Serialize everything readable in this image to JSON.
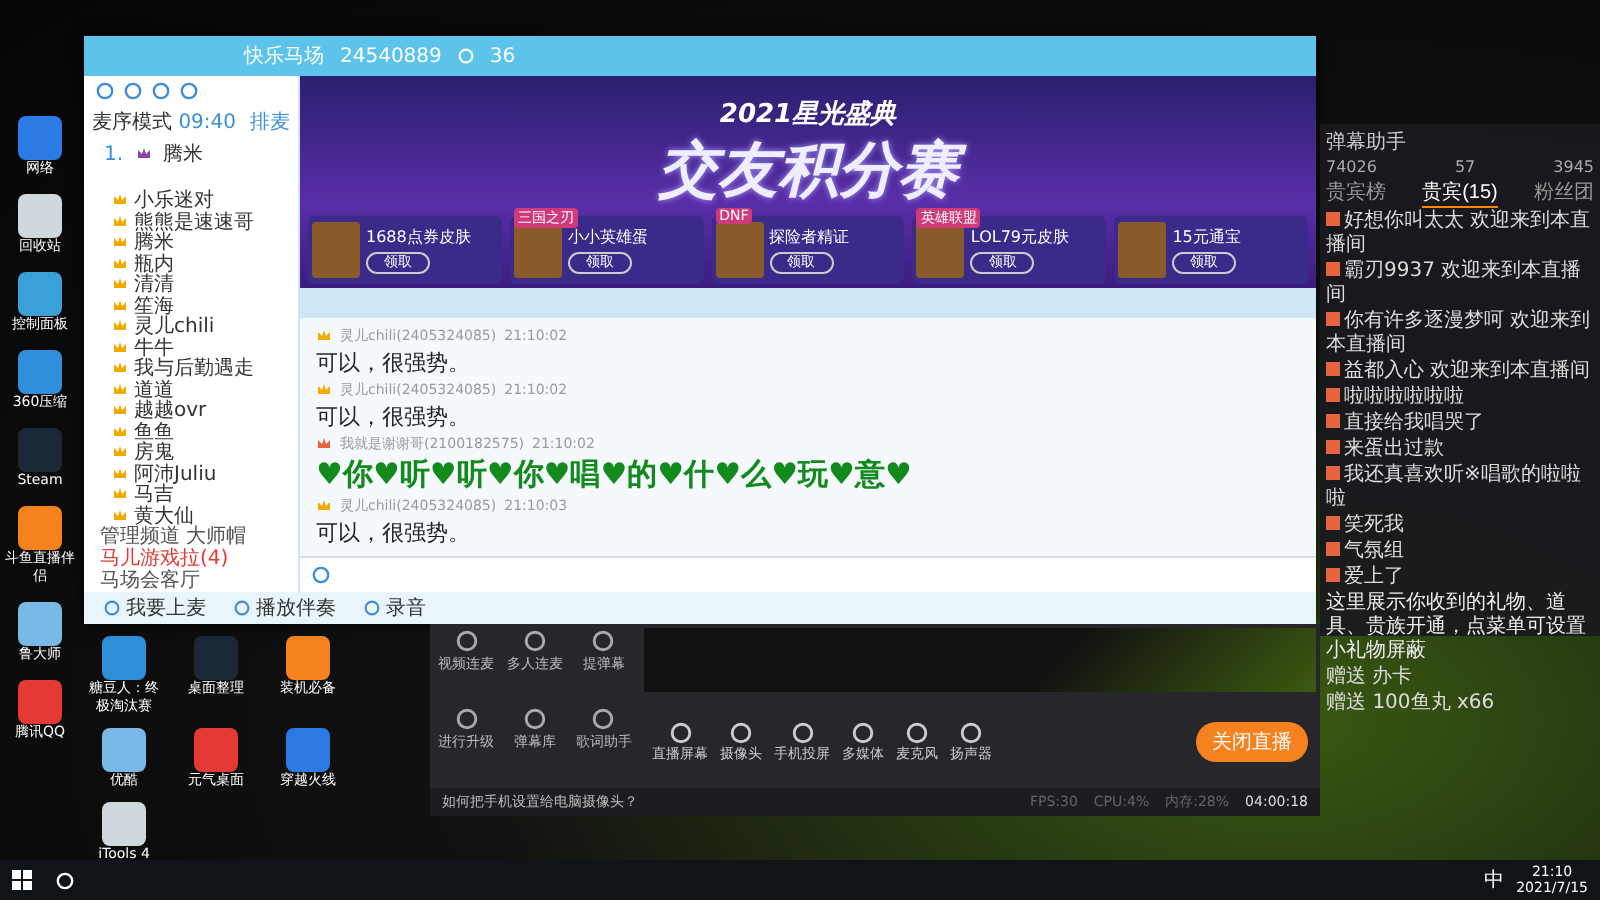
{
  "desktop_icons": [
    {
      "label": "网络"
    },
    {
      "label": "回收站"
    },
    {
      "label": "控制面板"
    },
    {
      "label": "360压缩"
    },
    {
      "label": "Steam"
    },
    {
      "label": "斗鱼直播伴侣"
    },
    {
      "label": "鲁大师"
    },
    {
      "label": "腾讯QQ"
    }
  ],
  "desktop_icons_bottom": [
    {
      "label": "糖豆人：终极淘汰赛"
    },
    {
      "label": "桌面整理"
    },
    {
      "label": "装机必备"
    },
    {
      "label": "优酷"
    },
    {
      "label": "元气桌面"
    },
    {
      "label": "穿越火线"
    },
    {
      "label": "iTools 4"
    }
  ],
  "group_window": {
    "title": "快乐马场",
    "room_id": "24540889",
    "online": "36",
    "mode": "麦序模式",
    "mode_time": "09:40",
    "queue_button": "排麦",
    "queue": [
      {
        "index": "1.",
        "name": "腾米"
      }
    ],
    "members": [
      {
        "name": "小乐迷对"
      },
      {
        "name": "熊熊是速速哥"
      },
      {
        "name": "腾米"
      },
      {
        "name": "瓶内"
      },
      {
        "name": "清清"
      },
      {
        "name": "笙海"
      },
      {
        "name": "灵儿chili"
      },
      {
        "name": "牛牛"
      },
      {
        "name": "我与后勤遇走"
      },
      {
        "name": "道道"
      },
      {
        "name": "越越ovr"
      },
      {
        "name": "鱼鱼"
      },
      {
        "name": "房鬼"
      },
      {
        "name": "阿沛Juliu"
      },
      {
        "name": "马吉"
      },
      {
        "name": "黄大仙"
      }
    ],
    "channels": [
      {
        "label": "管理频道 大师帽",
        "color": "#555555"
      },
      {
        "label": "马儿游戏拉(4)",
        "color": "#e53935"
      },
      {
        "label": "马场会客厅",
        "color": "#555555"
      }
    ],
    "toolbar": [
      {
        "label": "我要上麦"
      },
      {
        "label": "播放伴奏"
      },
      {
        "label": "录音"
      }
    ]
  },
  "banner": {
    "subtitle": "2021星光盛典",
    "title": "交友积分赛",
    "cards": [
      {
        "name": "1688点券皮肤",
        "button": "领取"
      },
      {
        "tag": "三国之刃",
        "name": "小小英雄蛋",
        "button": "领取"
      },
      {
        "tag": "DNF",
        "name": "探险者精证",
        "button": "领取"
      },
      {
        "tag": "英雄联盟",
        "name": "LOL79元皮肤",
        "button": "领取"
      },
      {
        "name": "15元通宝",
        "button": "领取"
      }
    ]
  },
  "messages": [
    {
      "kind": "plain",
      "sender": "灵儿chili(2405324085)",
      "time": "21:10:02",
      "text": "可以，很强势。"
    },
    {
      "kind": "plain",
      "sender": "灵儿chili(2405324085)",
      "time": "21:10:02",
      "text": "可以，很强势。"
    },
    {
      "kind": "big",
      "sender": "我就是谢谢哥(2100182575)",
      "time": "21:10:02",
      "text": "♥你♥听♥听♥你♥唱♥的♥什♥么♥玩♥意♥"
    },
    {
      "kind": "plain",
      "sender": "灵儿chili(2405324085)",
      "time": "21:10:03",
      "text": "可以，很强势。"
    }
  ],
  "right_panel": {
    "title": "弹幕助手",
    "stats": [
      {
        "value": "74026"
      },
      {
        "value": "57"
      },
      {
        "value": "3945"
      }
    ],
    "tabs": [
      {
        "label": "贵宾榜",
        "selected": false
      },
      {
        "label": "贵宾(15)",
        "selected": true
      },
      {
        "label": "粉丝团",
        "selected": false
      }
    ],
    "welcomes": [
      {
        "name": "好想你叫太太",
        "text": "欢迎来到本直播间"
      },
      {
        "name": "霸刃9937",
        "text": "欢迎来到本直播间"
      },
      {
        "name": "你有许多逐漫梦呵",
        "text": "欢迎来到本直播间"
      },
      {
        "name": "益都入心",
        "text": "欢迎来到本直播间"
      }
    ],
    "chat": [
      {
        "text": "啦啦啦啦啦啦"
      },
      {
        "text": "直接给我唱哭了"
      },
      {
        "text": "来蛋出过款"
      },
      {
        "text": "我还真喜欢听※唱歌的啦啦啦"
      },
      {
        "text": "笑死我"
      },
      {
        "text": "气氛组"
      },
      {
        "text": "爱上了"
      }
    ],
    "notice": "这里展示你收到的礼物、道具、贵族开通，点菜单可设置小礼物屏蔽",
    "gifts": [
      {
        "verb": "赠送",
        "item": "办卡"
      },
      {
        "verb": "赠送",
        "item": "100鱼丸",
        "count": "x66"
      }
    ]
  },
  "stream_app": {
    "tools": [
      {
        "label": "视频连麦"
      },
      {
        "label": "多人连麦"
      },
      {
        "label": "提弹幕"
      },
      {
        "label": "进行升级"
      },
      {
        "label": "弹幕库"
      },
      {
        "label": "歌词助手"
      }
    ],
    "controls": [
      {
        "label": "直播屏幕"
      },
      {
        "label": "摄像头"
      },
      {
        "label": "手机投屏"
      },
      {
        "label": "多媒体"
      },
      {
        "label": "麦克风"
      },
      {
        "label": "扬声器"
      }
    ],
    "stop_button": "关闭直播",
    "tip": "如何把手机设置给电脑摄像头？",
    "status": [
      {
        "text": "FPS:30"
      },
      {
        "text": "CPU:4%"
      },
      {
        "text": "内存:28%"
      }
    ],
    "timer": "04:00:18"
  },
  "taskbar": {
    "ime": "中",
    "time": "21:10",
    "date": "2021/7/15"
  }
}
